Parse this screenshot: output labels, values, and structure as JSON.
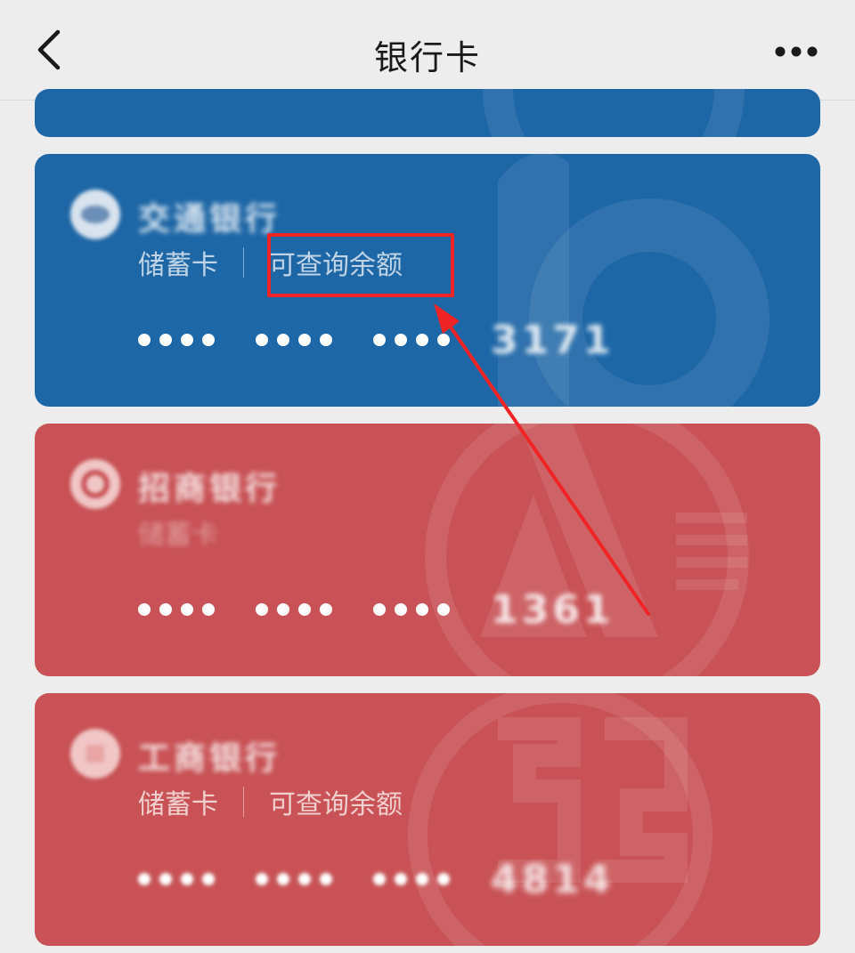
{
  "navbar": {
    "title": "银行卡",
    "back_icon": "chevron-left-icon",
    "more_icon": "more-horizontal-icon"
  },
  "colors": {
    "background": "#ededed",
    "card_blue": "#1e67a6",
    "card_red": "#c85255",
    "annotation": "#f02424"
  },
  "cards": [
    {
      "bank_name": "交通银行",
      "card_type": "储蓄卡",
      "balance_link": "可查询余额",
      "masked_groups": [
        "●●●●",
        "●●●●",
        "●●●●"
      ],
      "last4": "3171",
      "color": "blue",
      "logo_icon": "bank-logo-icon"
    },
    {
      "bank_name": "招商银行",
      "card_type": "储蓄卡",
      "balance_link": "",
      "masked_groups": [
        "●●●●",
        "●●●●",
        "●●●●"
      ],
      "last4": "1361",
      "color": "red",
      "logo_icon": "bank-logo-icon"
    },
    {
      "bank_name": "工商银行",
      "card_type": "储蓄卡",
      "balance_link": "可查询余额",
      "masked_groups": [
        "●●●●",
        "●●●●",
        "●●●●"
      ],
      "last4": "4814",
      "color": "red",
      "logo_icon": "bank-logo-icon"
    }
  ],
  "annotation": {
    "highlight": "balance-link-highlight",
    "arrow": "red-arrow-icon"
  }
}
